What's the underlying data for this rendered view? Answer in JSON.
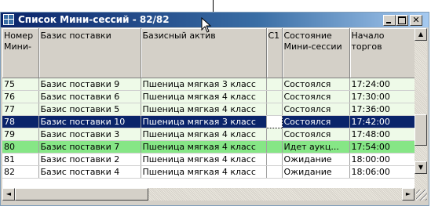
{
  "window": {
    "title": "Список Мини-сессий - 82/82",
    "controls": {
      "minimize": "",
      "maximize": "",
      "close": "✕"
    }
  },
  "table": {
    "columns": [
      "Номер Мини-",
      "Базис поставки",
      "Базисный актив",
      "C1",
      "Состояние Мини-сессии",
      "Начало торгов"
    ],
    "rows": [
      {
        "num": "75",
        "basis": "Базис поставки 9",
        "asset": "Пшеница мягкая 3 класс",
        "c1": "",
        "state": "Состоялся",
        "start": "17:24:00",
        "style": "light"
      },
      {
        "num": "76",
        "basis": "Базис поставки 6",
        "asset": "Пшеница мягкая 4 класс",
        "c1": "",
        "state": "Состоялся",
        "start": "17:30:00",
        "style": "light"
      },
      {
        "num": "77",
        "basis": "Базис поставки 5",
        "asset": "Пшеница мягкая 4 класс",
        "c1": "",
        "state": "Состоялся",
        "start": "17:36:00",
        "style": "light"
      },
      {
        "num": "78",
        "basis": "Базис поставки 10",
        "asset": "Пшеница мягкая 3 класс",
        "c1": "",
        "state": "Состоялся",
        "start": "17:42:00",
        "style": "sel"
      },
      {
        "num": "79",
        "basis": "Базис поставки 3",
        "asset": "Пшеница мягкая 4 класс",
        "c1": "",
        "state": "Состоялся",
        "start": "17:48:00",
        "style": "light"
      },
      {
        "num": "80",
        "basis": "Базис поставки 7",
        "asset": "Пшеница мягкая 4 класс",
        "c1": "",
        "state": "Идет аукц...",
        "start": "17:54:00",
        "style": "green"
      },
      {
        "num": "81",
        "basis": "Базис поставки 2",
        "asset": "Пшеница мягкая 4 класс",
        "c1": "",
        "state": "Ожидание",
        "start": "18:00:00",
        "style": "white"
      },
      {
        "num": "82",
        "basis": "Базис поставки 4",
        "asset": "Пшеница мягкая 4 класс",
        "c1": "",
        "state": "Ожидание",
        "start": "18:06:00",
        "style": "white"
      }
    ]
  },
  "scroll": {
    "up": "▲",
    "down": "▼",
    "left": "◄",
    "right": "►"
  },
  "colors": {
    "title_start": "#0a246a",
    "selected_row": "#0a246a",
    "active_row": "#86e686",
    "completed_row": "#eefae8"
  }
}
